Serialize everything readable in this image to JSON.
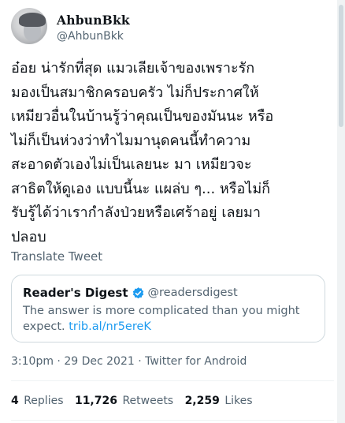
{
  "author": {
    "display_name": "AhbunBkk",
    "handle": "@AhbunBkk"
  },
  "tweet": {
    "lines": [
      "อ๋อย น่ารักที่สุด แมวเลียเจ้าของเพราะรัก",
      "มองเป็นสมาชิกครอบครัว ไม่ก็ประกาศให้",
      "เหมียวอื่นในบ้านรู้ว่าคุณเป็นของมันนะ หรือ",
      "ไม่ก็เป็นห่วงว่าทำไมมานุดคนนี้ทำความ",
      "สะอาดตัวเองไม่เป็นเลยนะ มา เหมียวจะ",
      "สาธิตให้ดูเอง แบบนี้นะ แผล่บ ๆ... หรือไม่ก็",
      "รับรู้ได้ว่าเรากำลังป่วยหรือเศร้าอยู่ เลยมา",
      "ปลอบ"
    ],
    "translate_label": "Translate Tweet"
  },
  "quote": {
    "name": "Reader's Digest",
    "handle": "@readersdigest",
    "text": "The answer is more complicated than you might expect.",
    "link": "trib.al/nr5ereK",
    "verified_color": "#1d9bf0"
  },
  "meta": {
    "time": "3:10pm",
    "date": "29 Dec 2021",
    "source": "Twitter for Android",
    "separator": "·"
  },
  "stats": {
    "replies_count": "4",
    "replies_label": "Replies",
    "retweets_count": "11,726",
    "retweets_label": "Retweets",
    "likes_count": "2,259",
    "likes_label": "Likes"
  },
  "colors": {
    "accent": "#1d9bf0",
    "text": "#0f1419",
    "secondary": "#536471",
    "border": "#cfd9de"
  }
}
